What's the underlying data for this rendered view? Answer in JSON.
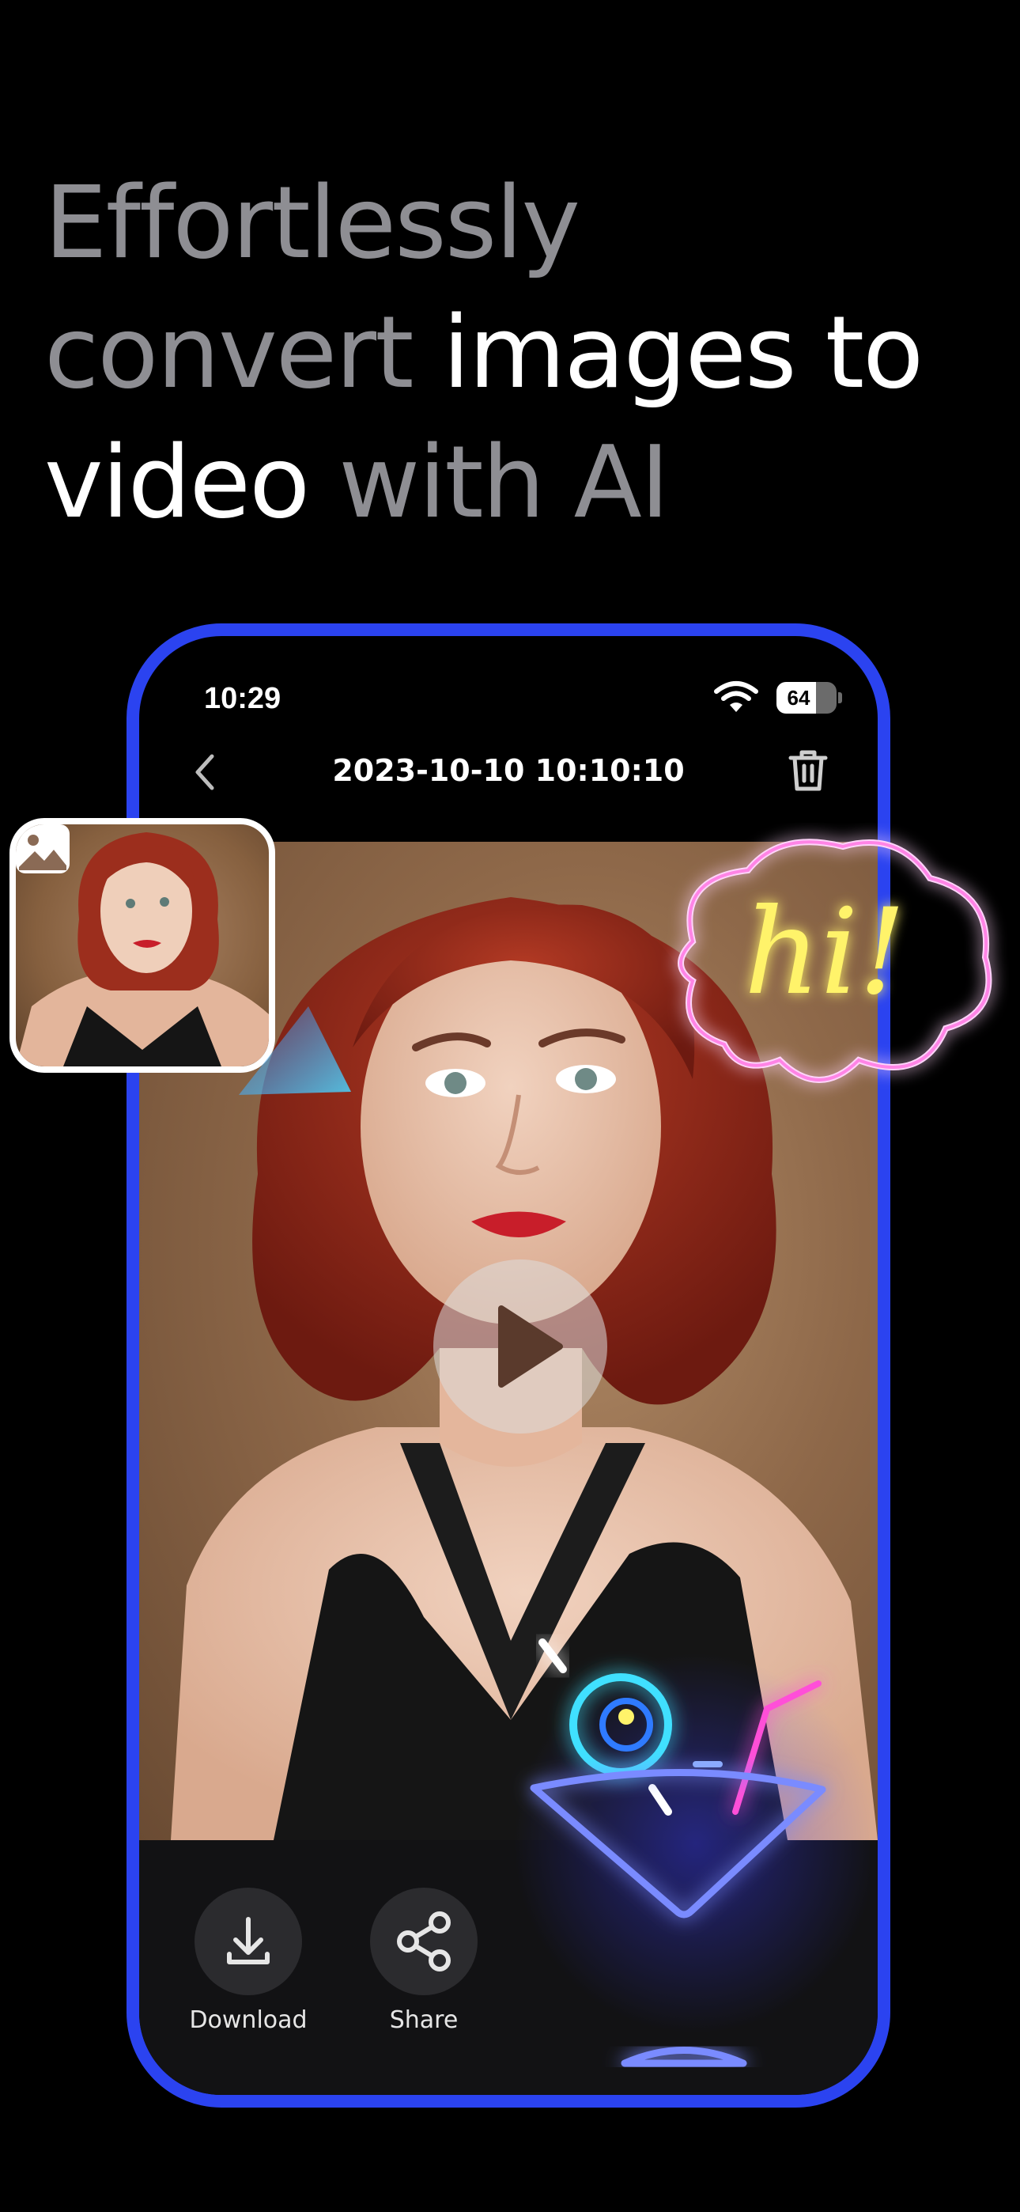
{
  "headline": {
    "line1_dim": "Effortlessly",
    "line2_dim": "convert ",
    "line2_bright": "images to",
    "line3_bright": "video",
    "line3_dim": " with AI"
  },
  "status_bar": {
    "time": "10:29",
    "battery_level": "64"
  },
  "nav": {
    "title": "2023-10-10 10:10:10"
  },
  "actions": {
    "download_label": "Download",
    "share_label": "Share"
  },
  "neon": {
    "bubble_text": "hi!"
  },
  "colors": {
    "frame_accent": "#2b43f0",
    "headline_dim": "#8e8e93",
    "toolbar_bg": "#121214",
    "neon_pink": "#ff4fd8",
    "neon_yellow": "#fff36a",
    "neon_blue": "#7a8bff",
    "neon_cyan": "#3fe0ff"
  },
  "icons": {
    "back": "chevron-left-icon",
    "delete": "trash-icon",
    "play": "play-icon",
    "download": "download-icon",
    "share": "share-icon",
    "image": "image-icon",
    "wifi": "wifi-icon",
    "battery": "battery-icon"
  }
}
